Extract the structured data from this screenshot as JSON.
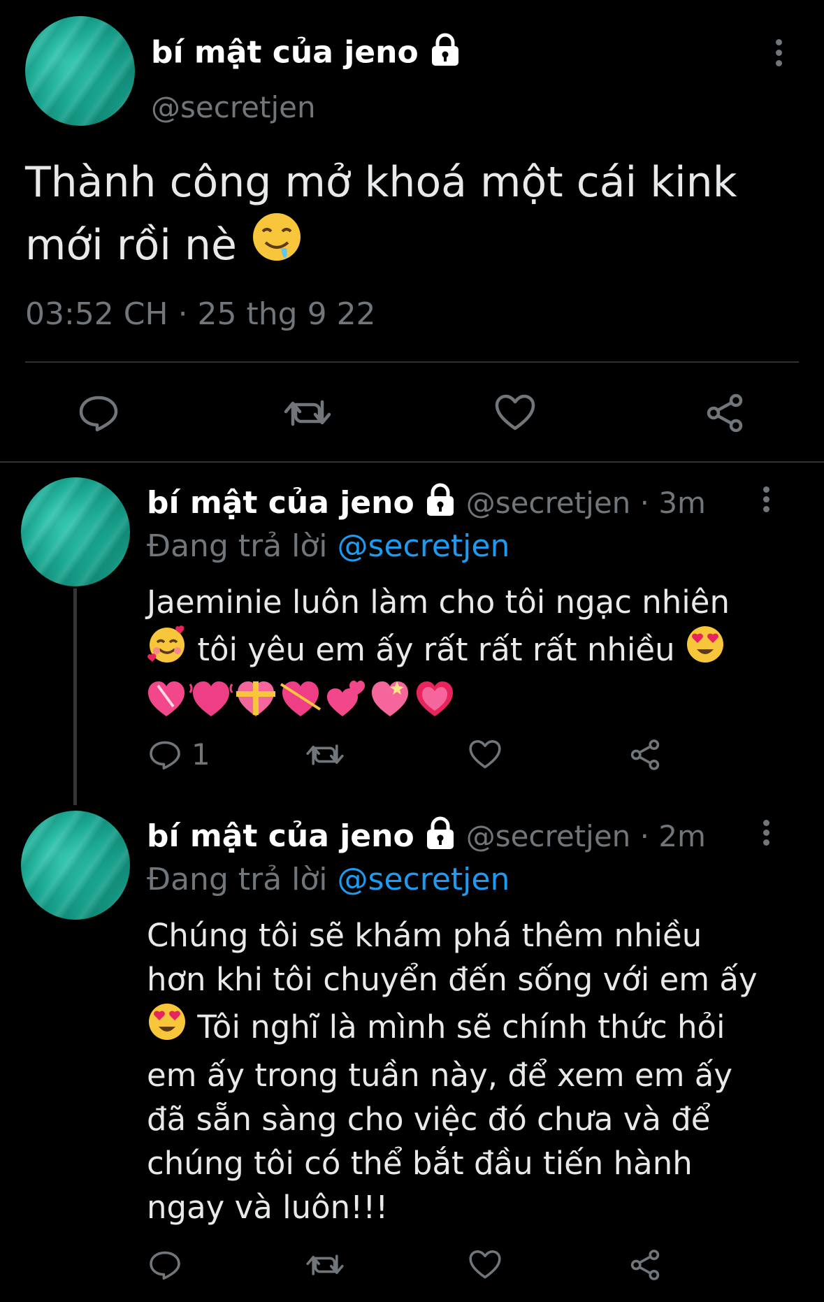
{
  "main_tweet": {
    "display_name": "bí mật của jeno",
    "handle": "@secretjen",
    "text_line1": "Thành công mở khoá một cái kink",
    "text_line2": "mới rồi nè",
    "timestamp": "03:52 CH · 25 thg 9 22"
  },
  "replies": [
    {
      "display_name": "bí mật của jeno",
      "handle_time": "@secretjen · 3m",
      "replying_to_label": "Đang trả lời",
      "replying_to_handle": "@secretjen",
      "line1": "Jaeminie luôn làm cho tôi ngạc nhiên",
      "line2": "tôi yêu em ấy rất rất rất nhiều",
      "reply_count": "1"
    },
    {
      "display_name": "bí mật của jeno",
      "handle_time": "@secretjen · 2m",
      "replying_to_label": "Đang trả lời",
      "replying_to_handle": "@secretjen",
      "line1": "Chúng tôi sẽ khám phá thêm nhiều",
      "line2": "hơn khi tôi chuyển đến sống với em ấy",
      "line3": "Tôi nghĩ là mình sẽ chính thức hỏi",
      "line4": "em ấy trong tuần này, để xem em ấy",
      "line5": "đã sẵn sàng cho việc đó chưa và để",
      "line6": "chúng tôi có thể bắt đầu tiến hành",
      "line7": "ngay và luôn!!!"
    }
  ],
  "icons": [
    "lock-icon",
    "more-icon",
    "reply-icon",
    "retweet-icon",
    "like-icon",
    "share-icon",
    "drooling-face-emoji",
    "smiling-hearts-emoji",
    "heart-eyes-emoji",
    "heart-emoji"
  ],
  "colors": {
    "background": "#000000",
    "text": "#e7e9ea",
    "secondary": "#71767b",
    "link": "#1d9bf0",
    "divider": "#2f3336",
    "avatar": "#1aa993"
  }
}
